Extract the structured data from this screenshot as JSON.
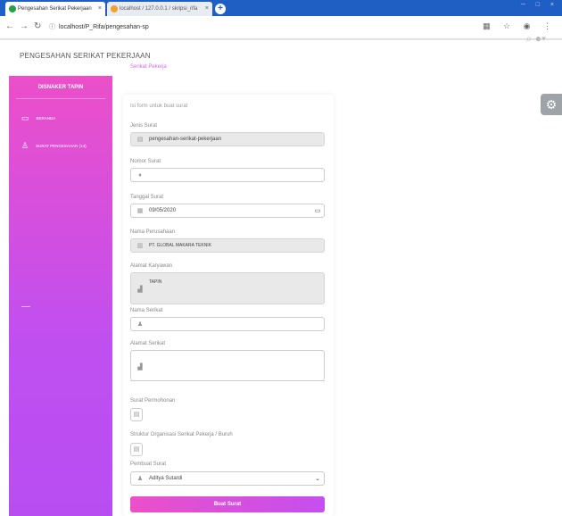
{
  "browser": {
    "tabs": [
      {
        "title": "Pengesahan Serikat Pekerjaan",
        "favicon_color": "#27a045"
      },
      {
        "title": "localhost / 127.0.0.1 / skripsi_rifa",
        "favicon_color": "#f0a030"
      }
    ],
    "url": "localhost/P_Rifa/pengesahan-sp"
  },
  "page": {
    "title": "PENGESAHAN SERIKAT PEKERJAAN",
    "breadcrumb": "Serikat Pekerja"
  },
  "sidebar": {
    "brand": "DISNAKER TAPIN",
    "items": [
      {
        "label": "BERANDA",
        "icon": "monitor-icon"
      },
      {
        "label": "SURAT PENGESAHAN (14)",
        "icon": "user-icon"
      }
    ]
  },
  "form": {
    "intro": "Isi form untuk buat surat",
    "jenis_label": "Jenis Surat",
    "jenis_value": "pengesahan-serikat-pekerjaan",
    "nomor_label": "Nomor Surat",
    "nomor_value": "",
    "tanggal_label": "Tanggal Surat",
    "tanggal_value": "09/05/2020",
    "perusahaan_label": "Nama Perusahaan",
    "perusahaan_value": "PT. GLOBAL MAKARA TEKNIK",
    "alamat_karyawan_label": "Alamat Karyawan",
    "alamat_karyawan_value": "TAPIN",
    "nama_serikat_label": "Nama Serikat",
    "nama_serikat_value": "",
    "alamat_serikat_label": "Alamat Serikat",
    "alamat_serikat_value": "",
    "permohonan_label": "Surat Permohonan",
    "struktur_label": "Struktur Organisasi Serikat Pekerja / Buruh",
    "pembuat_label": "Pembuat Surat",
    "pembuat_value": "Aditya Sutardi",
    "submit_label": "Buat Surat"
  }
}
